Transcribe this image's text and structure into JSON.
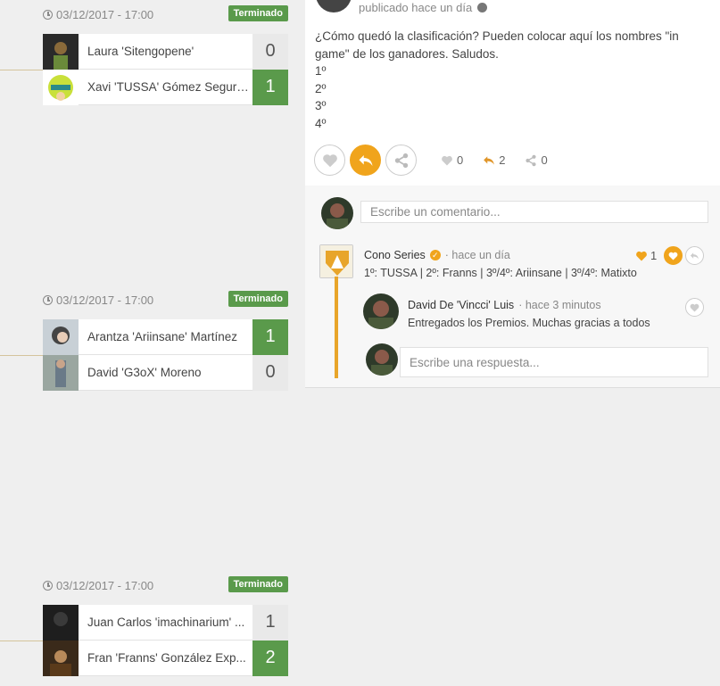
{
  "matches": [
    {
      "date": "03/12/2017 - 17:00",
      "status": "Terminado",
      "players": [
        {
          "name": "Laura 'Sitengopene'",
          "score": "0",
          "winner": false
        },
        {
          "name": "Xavi 'TUSSA' Gómez Segura...",
          "score": "1",
          "winner": true
        }
      ]
    },
    {
      "date": "03/12/2017 - 17:00",
      "status": "Terminado",
      "players": [
        {
          "name": "Arantza 'Ariinsane' Martínez",
          "score": "1",
          "winner": true
        },
        {
          "name": "David 'G3oX' Moreno",
          "score": "0",
          "winner": false
        }
      ]
    },
    {
      "date": "03/12/2017 - 17:00",
      "status": "Terminado",
      "players": [
        {
          "name": "Juan Carlos 'imachinarium' ...",
          "score": "1",
          "winner": false
        },
        {
          "name": "Fran 'Franns' González Exp...",
          "score": "2",
          "winner": true
        }
      ]
    }
  ],
  "post": {
    "published": "publicado hace un día",
    "text_lines": [
      "¿Cómo quedó la clasificación? Pueden colocar aquí los nombres \"in",
      "game\" de los ganadores. Saludos.",
      "1º",
      "2º",
      "3º",
      "4º"
    ],
    "likes": "0",
    "replies": "2",
    "shares": "0"
  },
  "comments": {
    "placeholder": "Escribe un comentario...",
    "main": {
      "author": "Cono Series",
      "time": "· hace un día",
      "text": "1º: TUSSA | 2º: Franns | 3º/4º: Ariinsane | 3º/4º: Matixto",
      "likes": "1"
    },
    "reply": {
      "author": "David De 'Vincci' Luis",
      "time": "· hace 3 minutos",
      "text": "Entregados los Premios. Muchas gracias a todos"
    },
    "reply_placeholder": "Escribe una respuesta..."
  },
  "colors": {
    "accent": "#f0a41c",
    "win": "#5a9a4b"
  }
}
